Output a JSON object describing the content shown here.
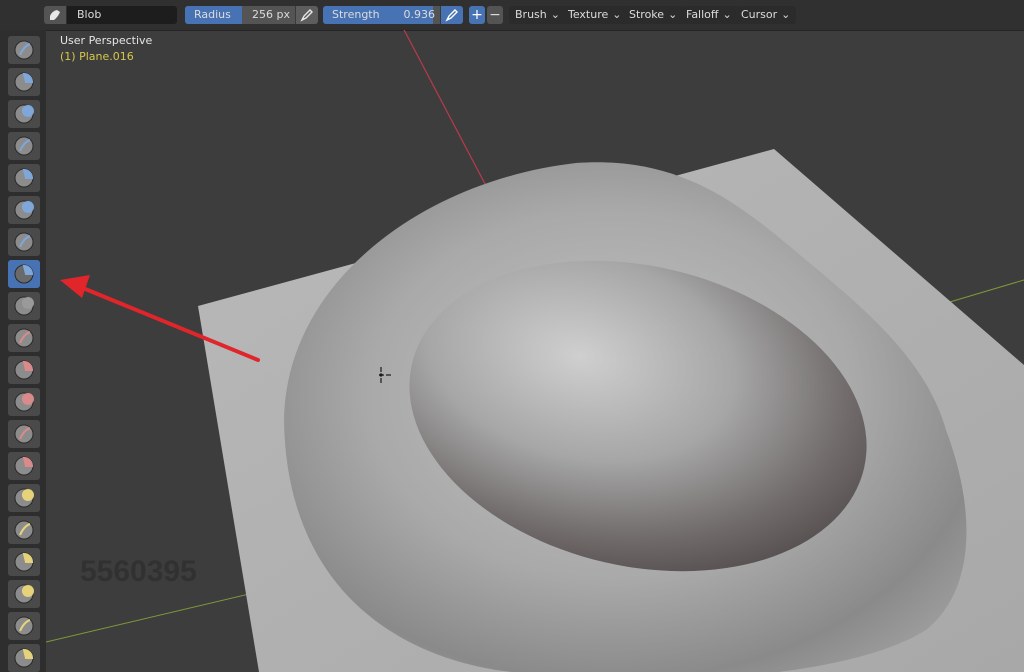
{
  "toolbar": {
    "brush_name": "Blob",
    "radius_label": "Radius",
    "radius_value": "256 px",
    "strength_label": "Strength",
    "strength_value": "0.936",
    "plus": "+",
    "minus": "−",
    "menus": [
      "Brush",
      "Texture",
      "Stroke",
      "Falloff",
      "Cursor"
    ]
  },
  "toolstrip": {
    "tools": [
      "draw-brush-icon",
      "draw-sharp-brush-icon",
      "clay-brush-icon",
      "clay-strips-brush-icon",
      "clay-thumb-brush-icon",
      "layer-brush-icon",
      "inflate-brush-icon",
      "blob-brush-icon",
      "crease-brush-icon",
      "smooth-brush-icon",
      "flatten-brush-icon",
      "fill-brush-icon",
      "scrape-brush-icon",
      "multiplane-scrape-brush-icon",
      "pinch-brush-icon",
      "grab-brush-icon",
      "elastic-deform-brush-icon",
      "snake-hook-brush-icon",
      "thumb-brush-icon",
      "pose-brush-icon"
    ],
    "active_index": 7,
    "accent": "#4772b3"
  },
  "viewport": {
    "view_name": "User Perspective",
    "object_name": "(1) Plane.016"
  },
  "watermark": "5560395",
  "colors": {
    "header_bg": "#303030",
    "viewport_bg": "#3d3d3d",
    "accent": "#4772b3",
    "annotation_arrow": "#e0252b",
    "object_label": "#d6c94a"
  },
  "sliders": {
    "strength_fraction": 0.936
  }
}
